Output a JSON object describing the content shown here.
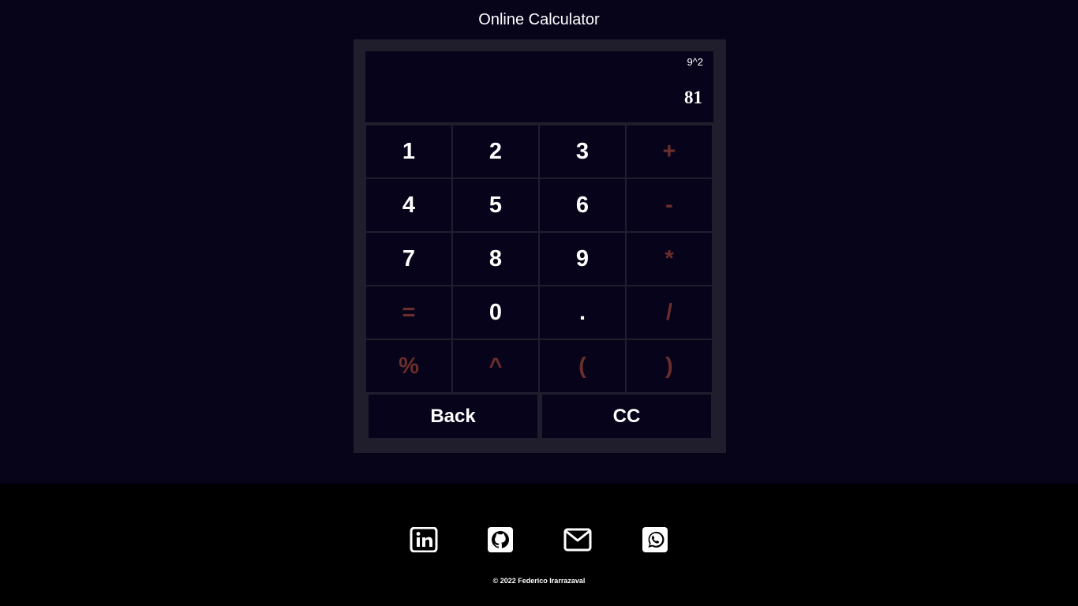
{
  "header": {
    "title": "Online Calculator"
  },
  "display": {
    "expression": "9^2",
    "result": "81"
  },
  "keypad": {
    "keys": [
      "1",
      "2",
      "3",
      "+",
      "4",
      "5",
      "6",
      "-",
      "7",
      "8",
      "9",
      "*",
      "=",
      "0",
      ".",
      "/",
      "%",
      "^",
      "(",
      ")"
    ],
    "back_label": "Back",
    "clear_label": "CC"
  },
  "colors": {
    "background": "#07041a",
    "calculator_frame": "#201e2d",
    "key_background": "#07031a",
    "digit_text": "#ffffff",
    "operator_text": "#6b2e2c",
    "footer_background": "#000000"
  },
  "footer": {
    "socials": [
      {
        "icon": "linkedin-icon"
      },
      {
        "icon": "github-icon"
      },
      {
        "icon": "email-icon"
      },
      {
        "icon": "whatsapp-icon"
      }
    ],
    "copyright": "© 2022 Federico Irarrazaval"
  }
}
